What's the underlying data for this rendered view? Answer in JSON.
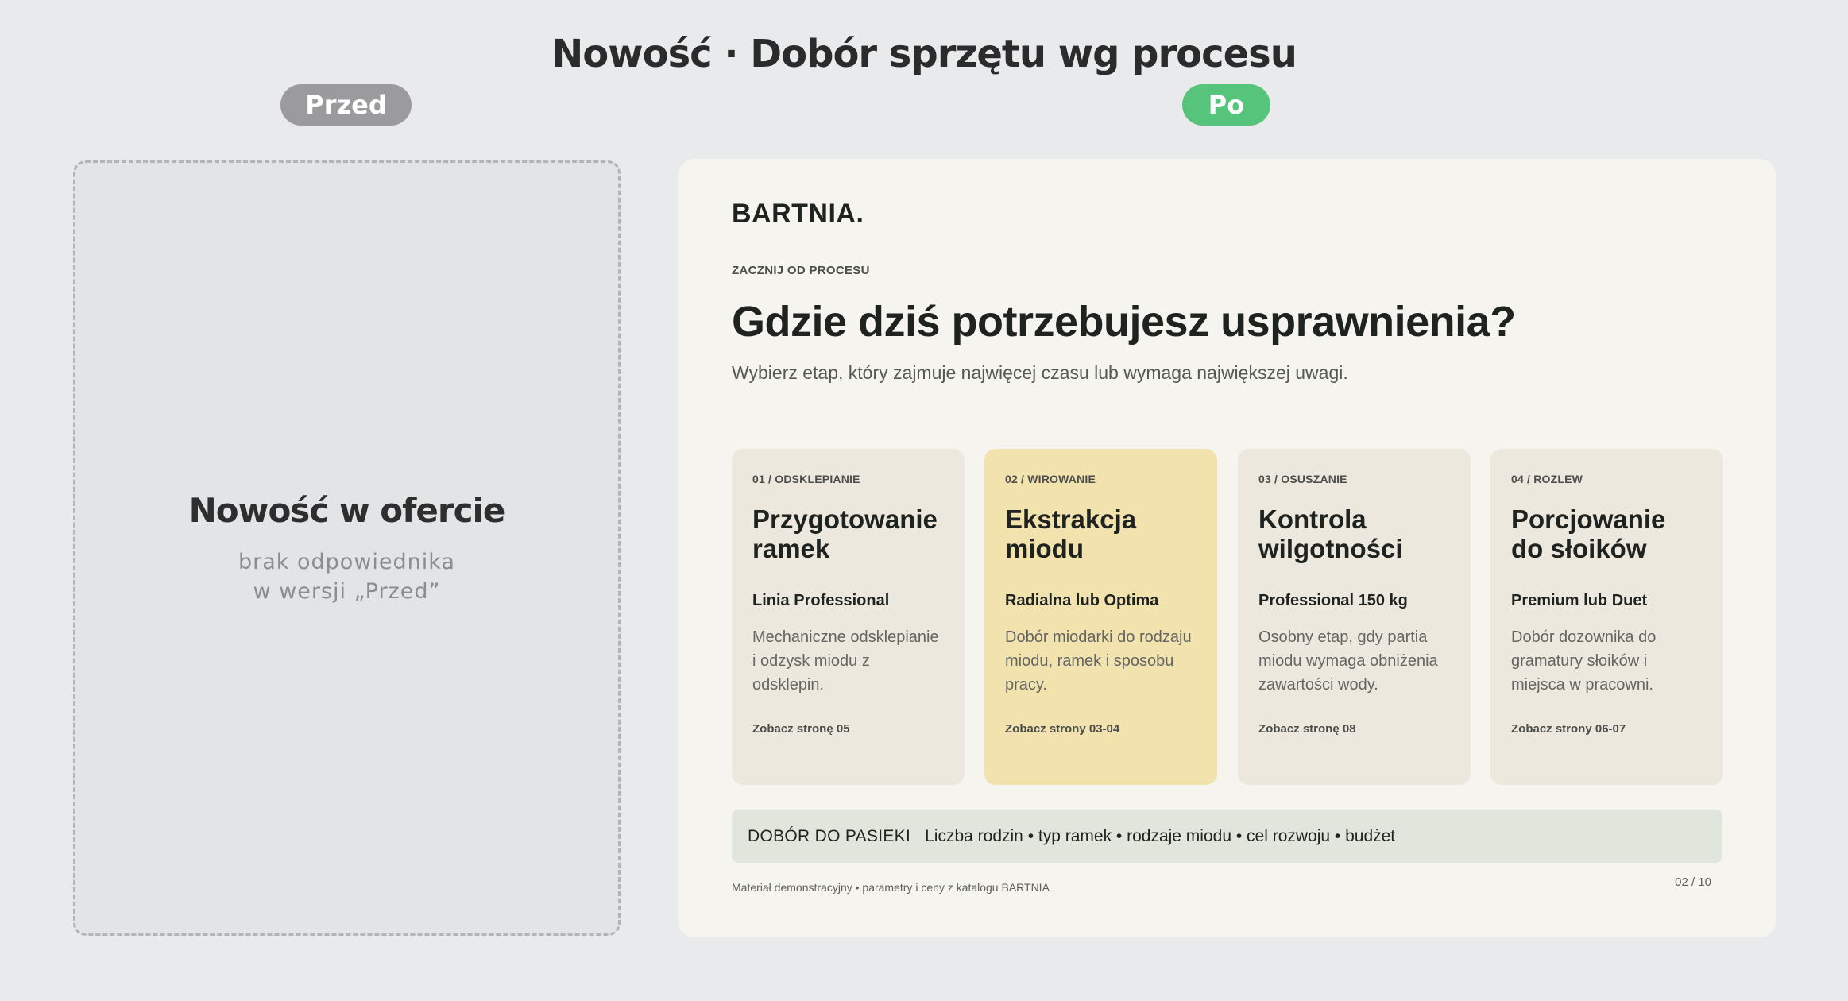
{
  "page": {
    "title": "Nowość · Dobór sprzętu wg procesu",
    "labels": {
      "before": "Przed",
      "after": "Po"
    }
  },
  "before": {
    "title": "Nowość w ofercie",
    "subtitle": "brak odpowiednika\nw wersji „Przed”"
  },
  "after": {
    "brand": "BARTNIA.",
    "eyebrow": "ZACZNIJ OD PROCESU",
    "headline": "Gdzie dziś potrzebujesz usprawnienia?",
    "lead": "Wybierz etap, który zajmuje najwięcej czasu lub wymaga największej uwagi.",
    "cards": [
      {
        "step": "01 / ODSKLEPIANIE",
        "title": "Przygotowanie ramek",
        "model": "Linia Professional",
        "description": "Mechaniczne odsklepianie i odzysk miodu z odsklepin.",
        "link": "Zobacz stronę 05"
      },
      {
        "step": "02 / WIROWANIE",
        "title": "Ekstrakcja miodu",
        "model": "Radialna lub Optima",
        "description": "Dobór miodarki do rodzaju miodu, ramek i sposobu pracy.",
        "link": "Zobacz strony 03-04"
      },
      {
        "step": "03 / OSUSZANIE",
        "title": "Kontrola wilgotności",
        "model": "Professional 150 kg",
        "description": "Osobny etap, gdy partia miodu wymaga obniżenia zawartości wody.",
        "link": "Zobacz stronę 08"
      },
      {
        "step": "04 / ROZLEW",
        "title": "Porcjowanie do słoików",
        "model": "Premium lub Duet",
        "description": "Dobór dozownika do gramatury słoików i miejsca w pracowni.",
        "link": "Zobacz strony 06-07"
      }
    ],
    "info_bar": {
      "label": "DOBÓR DO PASIEKI",
      "text": "Liczba rodzin • typ ramek • rodzaje miodu • cel rozwoju • budżet"
    },
    "footer_note": "Materiał demonstracyjny • parametry i ceny z katalogu BARTNIA",
    "page_number": "02 / 10"
  },
  "colors": {
    "background": "#e9eaec",
    "pill_before": "#9b9b9d",
    "pill_after": "#56c47b",
    "panel": "#f6f4ee",
    "card": "#ece8dd",
    "card_active": "#f2e2ae",
    "info_bar": "#e1e6dd"
  }
}
